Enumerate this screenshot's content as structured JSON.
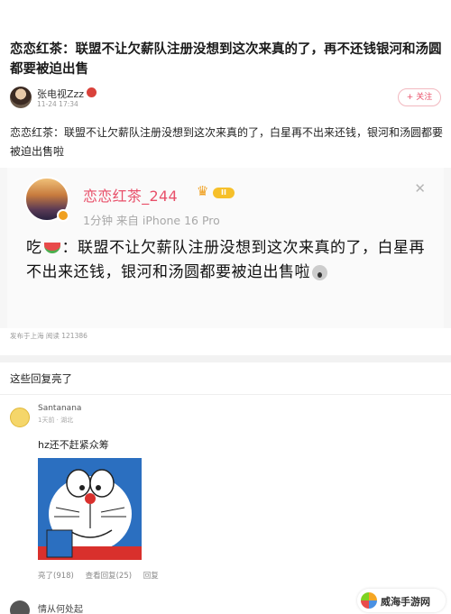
{
  "post": {
    "title": "恋恋红茶：联盟不让欠薪队注册没想到这次来真的了，再不还钱银河和汤圆都要被迫出售",
    "author": {
      "name": "张电视Zzz",
      "time": "11-24 17:34"
    },
    "follow_label": "+ 关注",
    "body": "恋恋红茶：联盟不让欠薪队注册没想到这次来真的了，白星再不出来还钱，银河和汤圆都要被迫出售啦",
    "footer": "发布于上海  阅读 121386"
  },
  "embed": {
    "name": "恋恋红茶_244",
    "level": "II",
    "meta": "1分钟  来自 iPhone 16 Pro",
    "close": "✕",
    "text_prefix": "吃",
    "text_body": "：联盟不让欠薪队注册没想到这次来真的了，白星再不出来还钱，银河和汤圆都要被迫出售啦"
  },
  "comments_section": {
    "title": "这些回复亮了",
    "comments": [
      {
        "name": "Santanana",
        "time": "1天前 · 湖北",
        "text": "hz还不赶紧众筹",
        "actions": {
          "like": "亮了(918)",
          "reply": "查看回复(25)",
          "more": "回复"
        }
      },
      {
        "name": "情从何处起"
      }
    ]
  },
  "watermark": "威海手游网"
}
